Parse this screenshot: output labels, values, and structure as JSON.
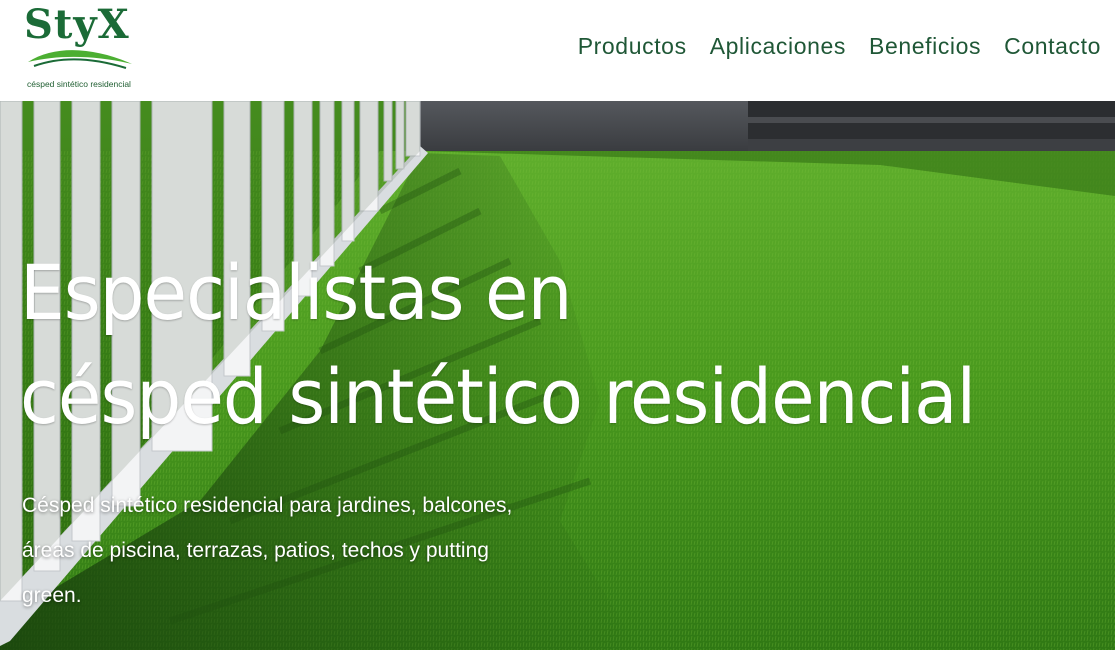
{
  "brand": {
    "name": "StyX",
    "tagline": "césped sintético residencial",
    "colors": {
      "primary": "#1b6b37",
      "accent": "#4caf32"
    }
  },
  "nav": {
    "items": [
      {
        "label": "Productos"
      },
      {
        "label": "Aplicaciones"
      },
      {
        "label": "Beneficios"
      },
      {
        "label": "Contacto"
      }
    ]
  },
  "hero": {
    "title_line1": "Especialistas en",
    "title_line2": "césped sintético residencial",
    "subtitle": "Césped sintético residencial para jardines, balcones, áreas de piscina, terrazas, patios, techos y putting green.",
    "image": "artificial-grass-lawn-with-white-picket-fence"
  }
}
